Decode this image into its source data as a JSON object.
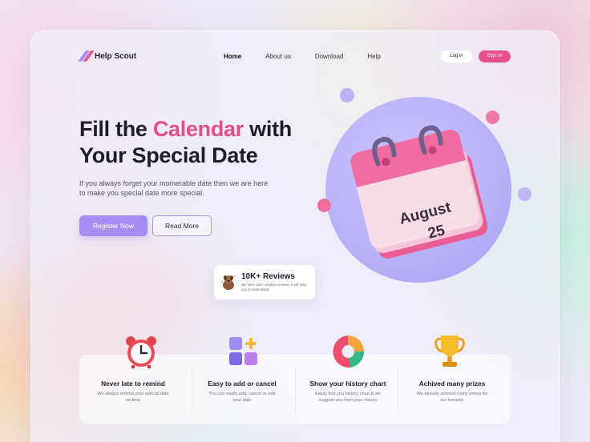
{
  "brand": {
    "name": "Help Scout",
    "colors": {
      "accent": "#e04f8a",
      "primary": "#a78cf3"
    }
  },
  "nav": {
    "items": [
      {
        "label": "Home",
        "active": true
      },
      {
        "label": "About us"
      },
      {
        "label": "Download"
      },
      {
        "label": "Help"
      }
    ],
    "login_label": "Log in",
    "signin_label": "Sign in"
  },
  "hero": {
    "title_part1": "Fill the",
    "title_highlight": "Calendar",
    "title_part2": "with",
    "title_line2": "Your Special Date",
    "subtitle": "If you always forget your momerable date then we are here to make you special date more special.",
    "register_label": "Register Now",
    "read_more_label": "Read More"
  },
  "calendar": {
    "month": "August",
    "day": "25"
  },
  "reviews": {
    "title": "10K+ Reviews",
    "text": "We have 10K+ positive reviews, it will help you to understand."
  },
  "features": [
    {
      "icon": "alarm-clock-icon",
      "title": "Never late to remind",
      "desc": "We always remind your special date on time"
    },
    {
      "icon": "blocks-add-icon",
      "title": "Easy to add or cancel",
      "desc": "You can easily add, cancel or edit your date"
    },
    {
      "icon": "pie-chart-icon",
      "title": "Show your history chart",
      "desc": "Easily find you history chart & we suggest you from your history"
    },
    {
      "icon": "trophy-icon",
      "title": "Achived many prizes",
      "desc": "We already achived many prizes for our honesty"
    }
  ]
}
